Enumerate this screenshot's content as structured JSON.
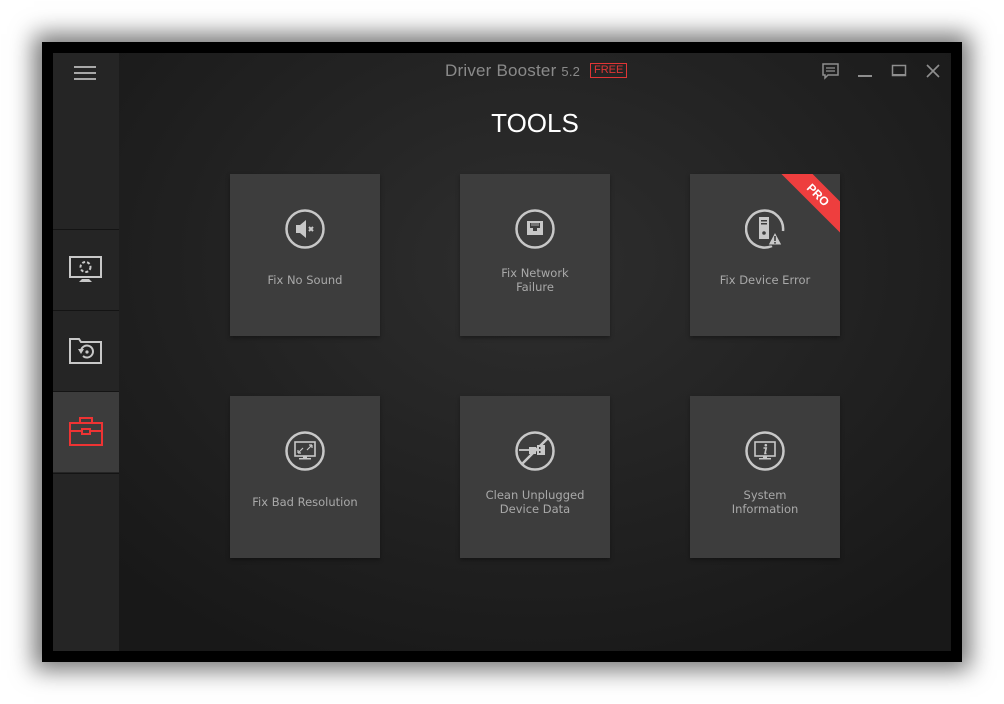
{
  "window": {
    "app_name": "Driver Booster",
    "version": "5.2",
    "edition_badge": "FREE",
    "controls": [
      {
        "name": "feedback",
        "icon": "chat-icon"
      },
      {
        "name": "minimize",
        "icon": "minimize-icon"
      },
      {
        "name": "maximize",
        "icon": "maximize-icon"
      },
      {
        "name": "close",
        "icon": "close-icon"
      }
    ]
  },
  "sidebar": {
    "menu_icon": "hamburger-menu-icon",
    "items": [
      {
        "id": "scan",
        "icon": "monitor-scan-icon",
        "active": false
      },
      {
        "id": "rescue-center",
        "icon": "folder-restore-icon",
        "active": false
      },
      {
        "id": "tools",
        "icon": "toolbox-icon",
        "active": true
      }
    ]
  },
  "main": {
    "title": "TOOLS",
    "tools": [
      {
        "id": "fix-no-sound",
        "label": "Fix No Sound",
        "icon": "speaker-mute-icon",
        "pro": false
      },
      {
        "id": "fix-network-failure",
        "label": "Fix Network\nFailure",
        "icon": "ethernet-port-icon",
        "pro": false
      },
      {
        "id": "fix-device-error",
        "label": "Fix Device Error",
        "icon": "device-warning-icon",
        "pro": true,
        "badge": "PRO"
      },
      {
        "id": "fix-bad-resolution",
        "label": "Fix Bad Resolution",
        "icon": "monitor-resize-icon",
        "pro": false
      },
      {
        "id": "clean-unplugged-device-data",
        "label": "Clean Unplugged\nDevice Data",
        "icon": "usb-unplugged-icon",
        "pro": false
      },
      {
        "id": "system-information",
        "label": "System\nInformation",
        "icon": "monitor-info-icon",
        "pro": false
      }
    ]
  },
  "colors": {
    "accent_red": "#e03535",
    "pro_ribbon": "#ee3e3e",
    "tile_bg": "#3d3d3d",
    "sidebar_bg": "#252525",
    "icon_gray": "#c8c8c8"
  }
}
